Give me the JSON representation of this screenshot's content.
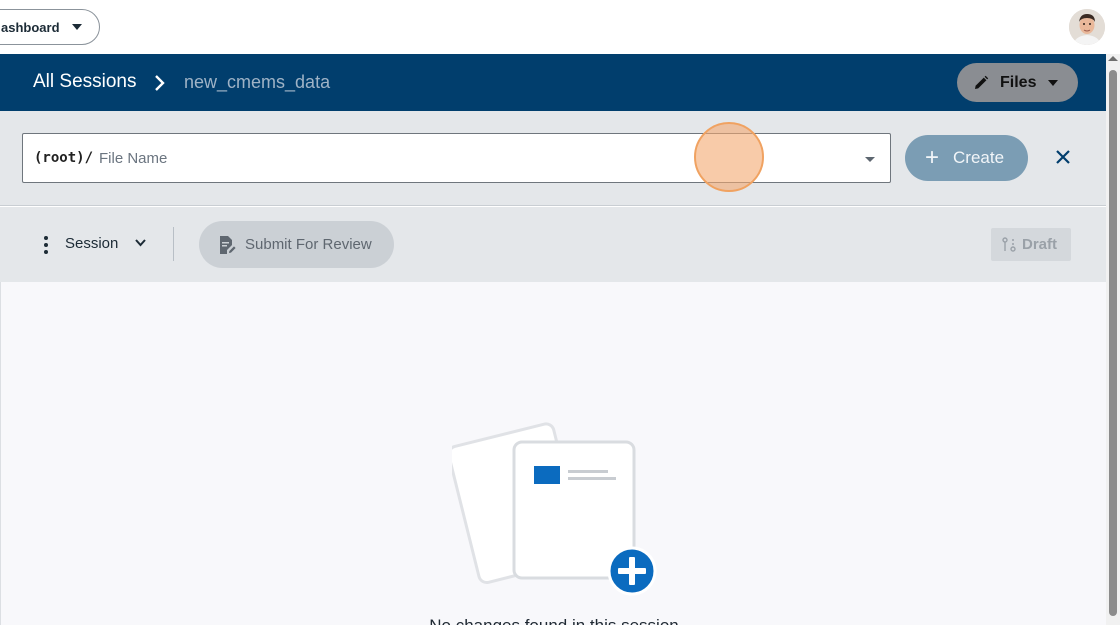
{
  "topbar": {
    "dashboard_label": "ashboard"
  },
  "header": {
    "breadcrumb_root": "All Sessions",
    "breadcrumb_current": "new_cmems_data",
    "files_label": "Files"
  },
  "file_row": {
    "prefix": "(root)/",
    "placeholder": "File Name",
    "value": "",
    "create_label": "Create"
  },
  "toolbar": {
    "session_label": "Session",
    "submit_label": "Submit For Review",
    "draft_label": "Draft"
  },
  "main": {
    "empty_message": "No changes found in this session"
  },
  "colors": {
    "header_bg": "#013e6d",
    "accent": "#0b6bbf",
    "create_btn": "#7b9db4",
    "toolbar_bg": "#e4e7ea"
  },
  "icons": [
    "chevron-down-icon",
    "avatar",
    "chevron-right-icon",
    "pencil-icon",
    "caret-down-icon",
    "plus-icon",
    "close-icon",
    "more-vertical-icon",
    "document-edit-icon",
    "draft-branch-icon",
    "empty-files-illustration",
    "add-circle-icon"
  ]
}
